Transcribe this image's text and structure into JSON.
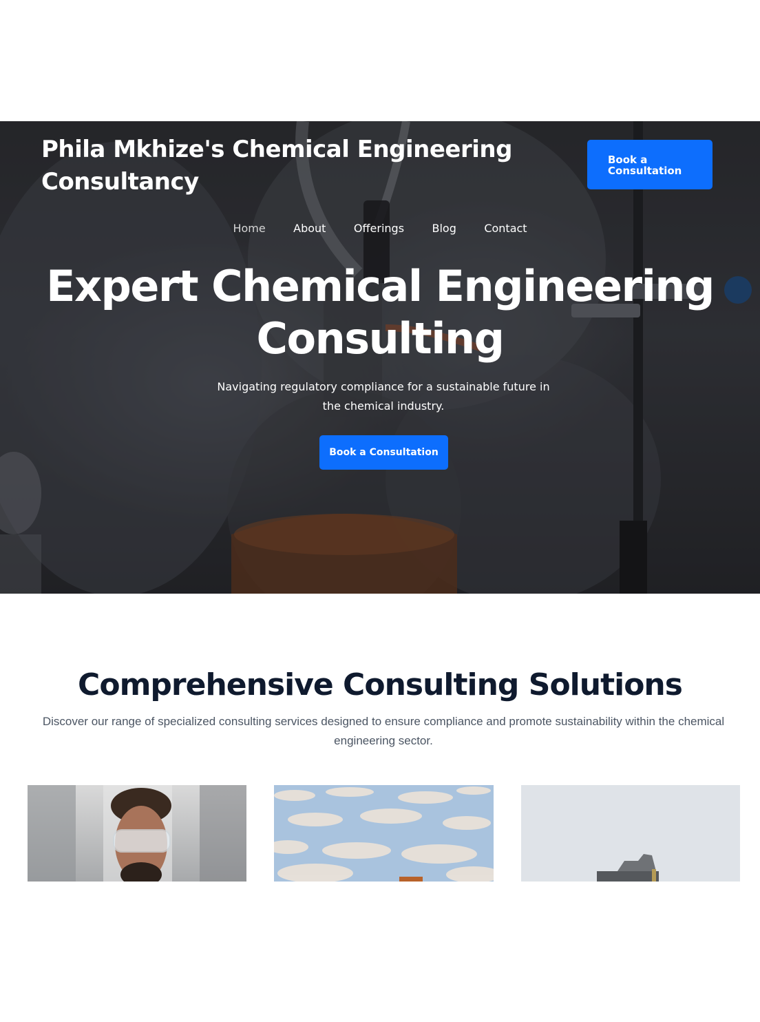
{
  "header": {
    "brand": "Phila Mkhize's Chemical Engineering Consultancy",
    "cta_label": "Book a Consultation"
  },
  "nav": {
    "items": [
      {
        "label": "Home",
        "active": true
      },
      {
        "label": "About"
      },
      {
        "label": "Offerings"
      },
      {
        "label": "Blog"
      },
      {
        "label": "Contact"
      }
    ]
  },
  "hero": {
    "title": "Expert Chemical Engineering Consulting",
    "subtitle": "Navigating regulatory compliance for a sustainable future in the chemical industry.",
    "cta_label": "Book a Consultation"
  },
  "solutions": {
    "title": "Comprehensive Consulting Solutions",
    "subtitle": "Discover our range of specialized consulting services designed to ensure compliance and promote sustainability within the chemical engineering sector."
  },
  "colors": {
    "accent": "#0d6efd",
    "heading_dark": "#0f1a2e",
    "body_text": "#4b5563"
  }
}
